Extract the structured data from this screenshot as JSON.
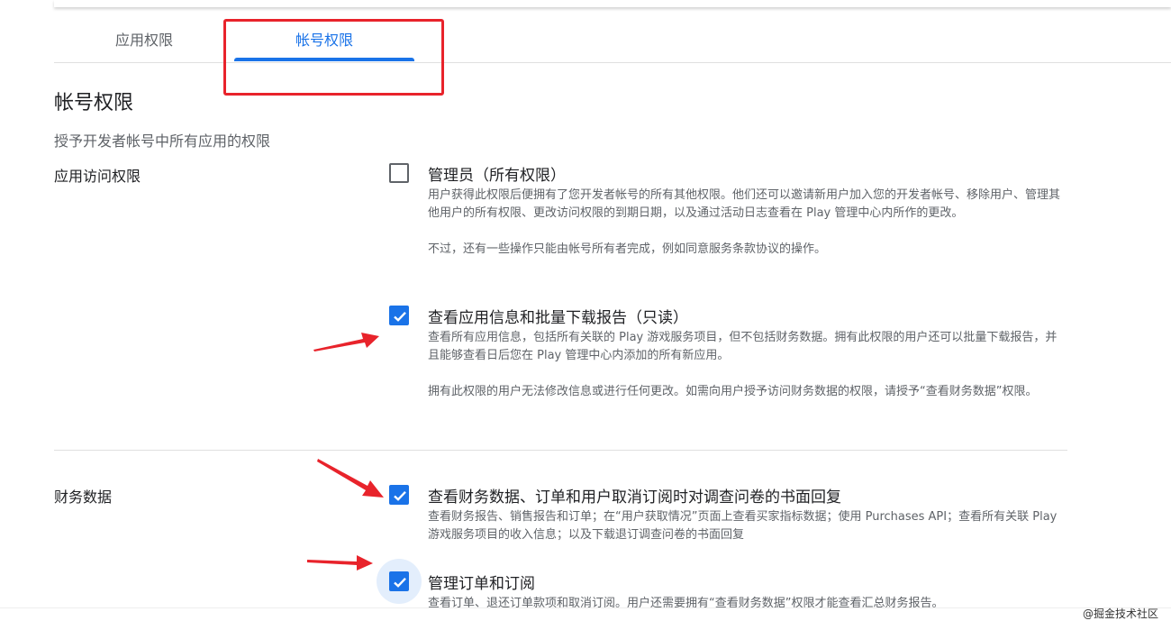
{
  "tabs": {
    "app_permissions": "应用权限",
    "account_permissions": "帐号权限"
  },
  "section": {
    "title": "帐号权限",
    "subtitle": "授予开发者帐号中所有应用的权限"
  },
  "groups": {
    "app_access": "应用访问权限",
    "financial": "财务数据"
  },
  "permissions": [
    {
      "title": "管理员（所有权限）",
      "checked": false,
      "desc": [
        "用户获得此权限后便拥有了您开发者帐号的所有其他权限。他们还可以邀请新用户加入您的开发者帐号、移除用户、管理其他用户的所有权限、更改访问权限的到期日期，以及通过活动日志查看在 Play 管理中心内所作的更改。",
        "不过，还有一些操作只能由帐号所有者完成，例如同意服务条款协议的操作。"
      ]
    },
    {
      "title": "查看应用信息和批量下载报告（只读）",
      "checked": true,
      "desc": [
        "查看所有应用信息，包括所有关联的 Play 游戏服务项目，但不包括财务数据。拥有此权限的用户还可以批量下载报告，并且能够查看日后您在 Play 管理中心内添加的所有新应用。",
        "拥有此权限的用户无法修改信息或进行任何更改。如需向用户授予访问财务数据的权限，请授予“查看财务数据”权限。"
      ]
    },
    {
      "title": "查看财务数据、订单和用户取消订阅时对调查问卷的书面回复",
      "checked": true,
      "desc": [
        "查看财务报告、销售报告和订单；在“用户获取情况”页面上查看买家指标数据；使用 Purchases API；查看所有关联 Play 游戏服务项目的收入信息；以及下载退订调查问卷的书面回复"
      ]
    },
    {
      "title": "管理订单和订阅",
      "checked": true,
      "desc": [
        "查看订单、退还订单款项和取消订阅。用户还需要拥有“查看财务数据”权限才能查看汇总财务报告。"
      ]
    }
  ],
  "watermark": "@掘金技术社区",
  "colors": {
    "accent": "#1a73e8",
    "annotation_red": "#e8232b"
  }
}
